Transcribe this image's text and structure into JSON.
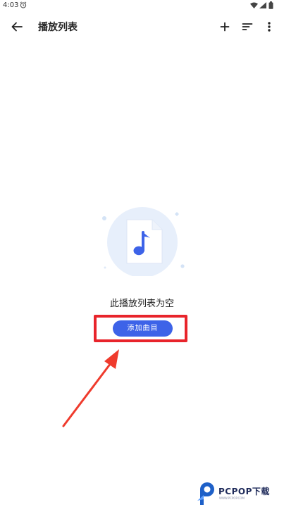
{
  "status_bar": {
    "time": "4:03",
    "icons": [
      "alarm-icon",
      "wifi-icon",
      "signal-icon",
      "battery-icon"
    ]
  },
  "app_bar": {
    "title": "播放列表",
    "actions": [
      "back-arrow-icon",
      "add-icon",
      "sort-icon",
      "more-vert-icon"
    ]
  },
  "empty_state": {
    "illustration": "music-file-icon",
    "message": "此播放列表为空",
    "button_label": "添加曲目"
  },
  "watermark": {
    "brand": "PCPOP下载",
    "sub": "WWW.PCPOP.COM"
  },
  "colors": {
    "accent": "#3d63e8",
    "highlight": "#e8242b",
    "illustration_bg": "#e7effb"
  }
}
